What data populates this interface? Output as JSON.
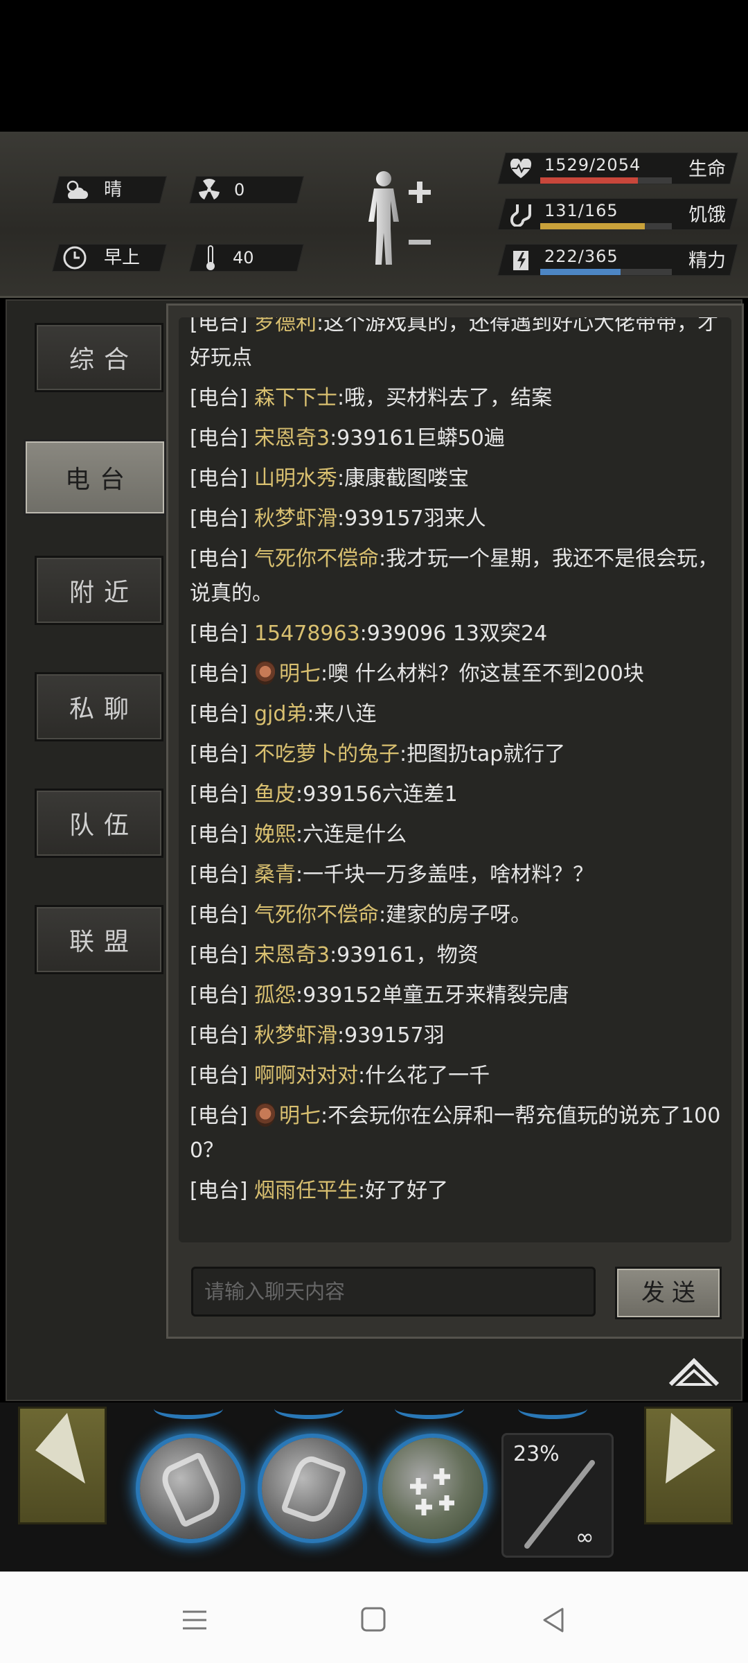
{
  "status": {
    "weather": "晴",
    "radiation": "0",
    "time_of_day": "早上",
    "temperature": "40",
    "stats": [
      {
        "key": "health",
        "value": "1529/2054",
        "label": "生命",
        "fraction": 0.744,
        "color": "#c9473b"
      },
      {
        "key": "hunger",
        "value": "131/165",
        "label": "饥饿",
        "fraction": 0.794,
        "color": "#c9a13a"
      },
      {
        "key": "energy",
        "value": "222/365",
        "label": "精力",
        "fraction": 0.608,
        "color": "#4d86c4"
      }
    ],
    "colors": {
      "panel": "#2b2a26"
    }
  },
  "tabs": [
    {
      "label": "综合",
      "active": false
    },
    {
      "label": "电台",
      "active": true
    },
    {
      "label": "附近",
      "active": false
    },
    {
      "label": "私聊",
      "active": false
    },
    {
      "label": "队伍",
      "active": false
    },
    {
      "label": "联盟",
      "active": false
    }
  ],
  "chat": {
    "messages": [
      {
        "channel": "[电台]",
        "name": "罗德利",
        "text": ":这个游戏真的，还得遇到好心大佬带带，才好玩点",
        "badge": false
      },
      {
        "channel": "[电台]",
        "name": "森下下士",
        "text": ":哦，买材料去了，结案",
        "badge": false
      },
      {
        "channel": "[电台]",
        "name": "宋恩奇3",
        "text": ":939161巨蟒50遍",
        "badge": false
      },
      {
        "channel": "[电台]",
        "name": "山明水秀",
        "text": ":康康截图喽宝",
        "badge": false
      },
      {
        "channel": "[电台]",
        "name": "秋梦虾滑",
        "text": ":939157羽来人",
        "badge": false
      },
      {
        "channel": "[电台]",
        "name": "气死你不偿命",
        "text": ":我才玩一个星期，我还不是很会玩，说真的。",
        "badge": false
      },
      {
        "channel": "[电台]",
        "name": "15478963",
        "text": ":939096 13双突24",
        "badge": false
      },
      {
        "channel": "[电台]",
        "name": "明七",
        "text": ":噢 什么材料？你这甚至不到200块",
        "badge": true
      },
      {
        "channel": "[电台]",
        "name": "gjd弟",
        "text": ":来八连",
        "badge": false
      },
      {
        "channel": "[电台]",
        "name": "不吃萝卜的兔子",
        "text": ":把图扔tap就行了",
        "badge": false
      },
      {
        "channel": "[电台]",
        "name": "鱼皮",
        "text": ":939156六连差1",
        "badge": false
      },
      {
        "channel": "[电台]",
        "name": "娩熙",
        "text": ":六连是什么",
        "badge": false
      },
      {
        "channel": "[电台]",
        "name": "桑青",
        "text": ":一千块一万多盖哇，啥材料？？",
        "badge": false
      },
      {
        "channel": "[电台]",
        "name": "气死你不偿命",
        "text": ":建家的房子呀。",
        "badge": false
      },
      {
        "channel": "[电台]",
        "name": "宋恩奇3",
        "text": ":939161，物资",
        "badge": false
      },
      {
        "channel": "[电台]",
        "name": "孤怨",
        "text": ":939152单童五牙来精裂完唐",
        "badge": false
      },
      {
        "channel": "[电台]",
        "name": "秋梦虾滑",
        "text": ":939157羽",
        "badge": false
      },
      {
        "channel": "[电台]",
        "name": "啊啊对对对",
        "text": ":什么花了一千",
        "badge": false
      },
      {
        "channel": "[电台]",
        "name": "明七",
        "text": ":不会玩你在公屏和一帮充值玩的说充了1000？",
        "badge": true
      },
      {
        "channel": "[电台]",
        "name": "烟雨任平生",
        "text": ":好了好了",
        "badge": false
      }
    ],
    "input_placeholder": "请输入聊天内容",
    "send_label": "发送"
  },
  "hud": {
    "durability": "23%",
    "ammo": "∞",
    "icons": [
      "skill-axe-icon",
      "skill-fist-icon",
      "skill-heal-icon",
      "weapon-stick-icon"
    ]
  },
  "icons": [
    "sun-cloud-icon",
    "radiation-icon",
    "clock-icon",
    "thermometer-icon",
    "body-icon",
    "heart-icon",
    "stomach-icon",
    "energy-icon",
    "collapse-icon",
    "menu-icon",
    "home-icon",
    "back-icon"
  ]
}
